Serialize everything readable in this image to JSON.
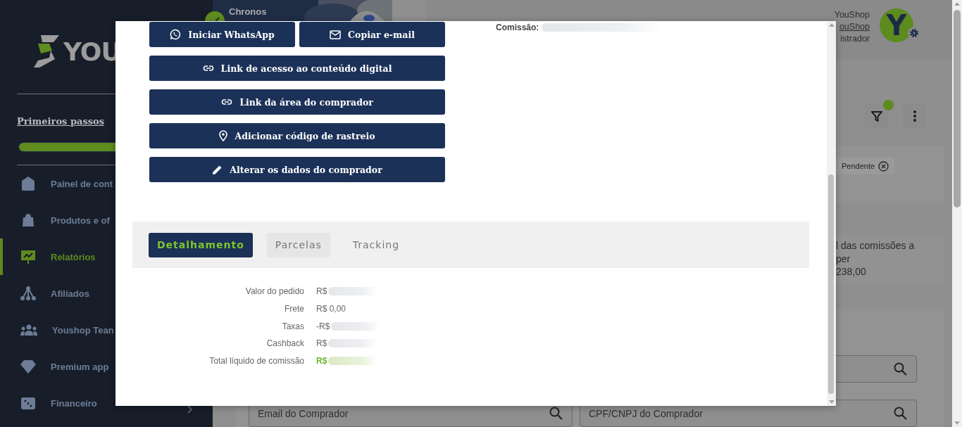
{
  "sidebar": {
    "logo_text": "YOU",
    "onboarding": {
      "label": "Primeiros passos",
      "level": 1
    },
    "items": [
      {
        "label": "Painel de cont",
        "selected": false
      },
      {
        "label": "Produtos e of",
        "selected": false
      },
      {
        "label": "Relatórios",
        "selected": true
      },
      {
        "label": "Afiliados",
        "selected": false
      },
      {
        "label": "Youshop Tean",
        "selected": false
      },
      {
        "label": "Premium app",
        "selected": false
      },
      {
        "label": "Financeiro",
        "selected": false,
        "expandable": true
      }
    ]
  },
  "header": {
    "banner_title": "Chronos",
    "user": {
      "name": "YouShop",
      "link": "ouShop",
      "role": "istrador",
      "avatar_letter": "Y"
    }
  },
  "toolbar": {
    "filter_active": true
  },
  "filter_chips": [
    {
      "label": "Pendente"
    }
  ],
  "summary_card": {
    "lines": [
      "l das comissões a",
      "per",
      "238,00"
    ]
  },
  "search_fields": [
    {
      "placeholder": "Email do Comprador"
    },
    {
      "placeholder": "CPF/CNPJ do Comprador"
    }
  ],
  "modal": {
    "action_rows": [
      {
        "buttons": [
          {
            "label": "Iniciar WhatsApp"
          },
          {
            "label": "Copiar e-mail"
          }
        ]
      },
      {
        "buttons": [
          {
            "label": "Link de acesso ao conteúdo digital"
          }
        ]
      },
      {
        "buttons": [
          {
            "label": "Link da área do comprador"
          }
        ]
      },
      {
        "buttons": [
          {
            "label": "Adicionar código de rastreio"
          }
        ]
      },
      {
        "buttons": [
          {
            "label": "Alterar os dados do comprador"
          }
        ]
      }
    ],
    "commission_label": "Comissão:",
    "tabs": [
      {
        "label": "Detalhamento",
        "selected": true,
        "hovered": false
      },
      {
        "label": "Parcelas",
        "selected": false,
        "hovered": true
      },
      {
        "label": "Tracking",
        "selected": false,
        "hovered": false
      }
    ],
    "details": [
      {
        "label": "Valor do pedido",
        "value": "R$",
        "redacted": true,
        "highlight": false
      },
      {
        "label": "Frete",
        "value": "R$ 0,00",
        "redacted": false,
        "highlight": false
      },
      {
        "label": "Taxas",
        "value": "-R$",
        "redacted": true,
        "highlight": false
      },
      {
        "label": "Cashback",
        "value": "R$",
        "redacted": true,
        "highlight": false
      },
      {
        "label": "Total líquido de comissão",
        "value": "R$",
        "redacted": true,
        "highlight": true
      }
    ]
  }
}
